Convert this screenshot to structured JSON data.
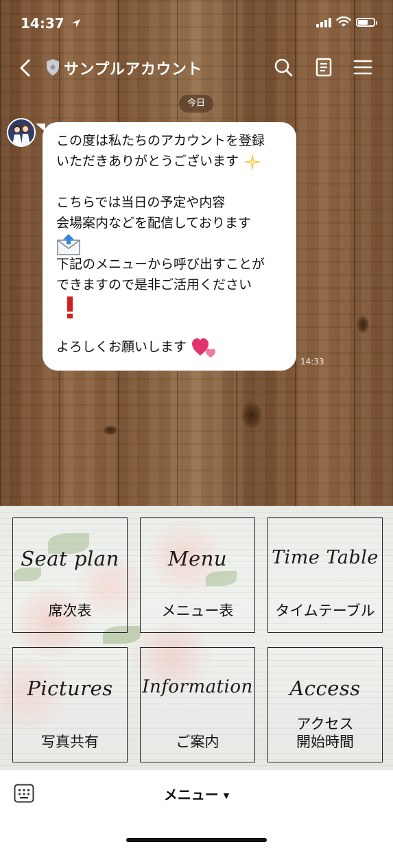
{
  "status_bar": {
    "time": "14:37"
  },
  "header": {
    "account_name": "サンプルアカウント"
  },
  "chat": {
    "date_label": "今日",
    "message": {
      "lines": [
        "この度は私たちのアカウントを登録",
        "いただきありがとうございます",
        "",
        "こちらでは当日の予定や内容",
        "会場案内などを配信しております",
        "",
        "下記のメニューから呼び出すことが",
        "できますので是非ご活用ください",
        "",
        "",
        "よろしくお願いします"
      ],
      "time": "14:33"
    }
  },
  "rich_menu": {
    "buttons": [
      {
        "script": "Seat plan",
        "label": "席次表"
      },
      {
        "script": "Menu",
        "label": "メニュー表"
      },
      {
        "script": "Time Table",
        "label": "タイムテーブル"
      },
      {
        "script": "Pictures",
        "label": "写真共有"
      },
      {
        "script": "Information",
        "label": "ご案内"
      },
      {
        "script": "Access",
        "label_line1": "アクセス",
        "label_line2": "開始時間"
      }
    ]
  },
  "bottom_bar": {
    "menu_label": "メニュー"
  },
  "icons": {
    "location": "location-arrow-icon",
    "signal": "signal-icon",
    "wifi": "wifi-icon",
    "battery": "battery-icon",
    "back": "chevron-left-icon",
    "verified": "shield-icon",
    "search": "search-icon",
    "notes": "note-icon",
    "menu": "hamburger-icon",
    "keyboard": "keyboard-icon"
  }
}
